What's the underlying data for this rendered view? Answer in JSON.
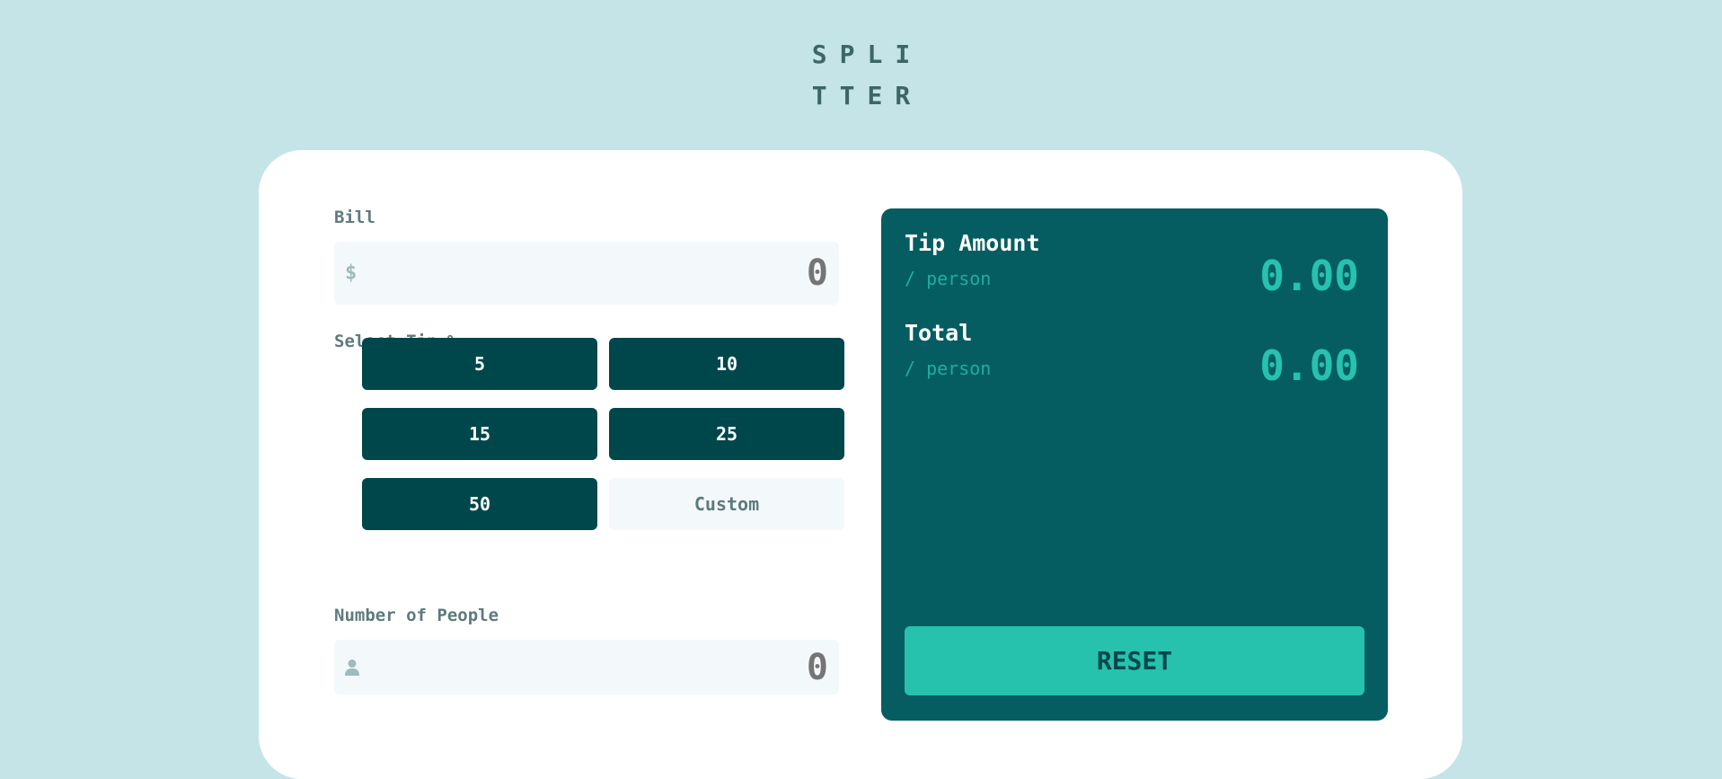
{
  "logo": {
    "line1": "SPLI",
    "line2": "TTER"
  },
  "bill": {
    "label": "Bill",
    "currency_symbol": "$",
    "placeholder": "0"
  },
  "tip": {
    "label": "Select Tip %",
    "options": [
      "5",
      "10",
      "15",
      "25",
      "50"
    ],
    "custom_placeholder": "Custom"
  },
  "people": {
    "label": "Number of People",
    "placeholder": "0",
    "icon": "person-icon"
  },
  "results": {
    "tip_amount": {
      "title": "Tip Amount",
      "sub": "/ person",
      "value": "0.00"
    },
    "total": {
      "title": "Total",
      "sub": "/ person",
      "value": "0.00"
    },
    "reset_label": "RESET"
  },
  "colors": {
    "background": "#c5e4e7",
    "dark_cyan": "#00474b",
    "panel": "#055d61",
    "accent": "#26c2ad",
    "input_bg": "#f3f9fa",
    "label": "#5e7a7d"
  }
}
